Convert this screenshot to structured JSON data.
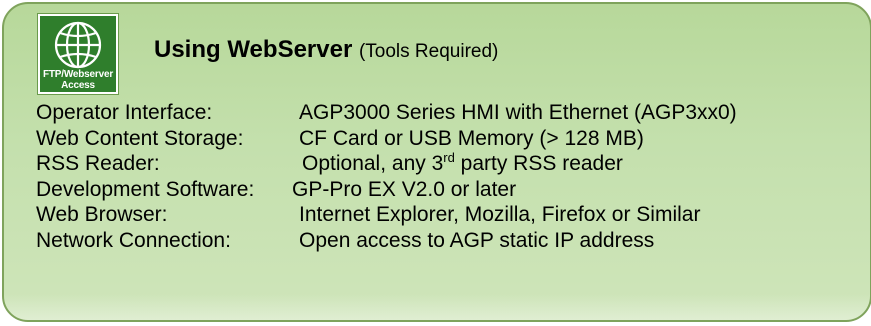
{
  "badge": {
    "icon": "globe-icon",
    "line1": "FTP/Webserver",
    "line2": "Access",
    "colors": {
      "background": "#2f7e2c",
      "text": "#ffffff"
    }
  },
  "heading": {
    "bold": "Using WebServer",
    "note": "(Tools Required)"
  },
  "requirements": [
    {
      "label": "Operator Interface:",
      "value": "AGP3000 Series HMI with Ethernet (AGP3xx0)"
    },
    {
      "label": "Web Content Storage:",
      "value": "CF Card or USB Memory (> 128 MB)"
    },
    {
      "label": "RSS Reader:",
      "value_pre": "Optional, any 3",
      "value_sup": "rd",
      "value_post": " party RSS reader"
    },
    {
      "label": "Development Software:",
      "value": "GP-Pro EX V2.0 or later"
    },
    {
      "label": "Web Browser:",
      "value": "Internet Explorer, Mozilla, Firefox or Similar"
    },
    {
      "label": "Network Connection:",
      "value": "Open access to AGP static IP address"
    }
  ],
  "colors": {
    "panel_top": "#b7d89a",
    "panel_bottom": "#cfe5ba",
    "border": "#7fa35c"
  }
}
